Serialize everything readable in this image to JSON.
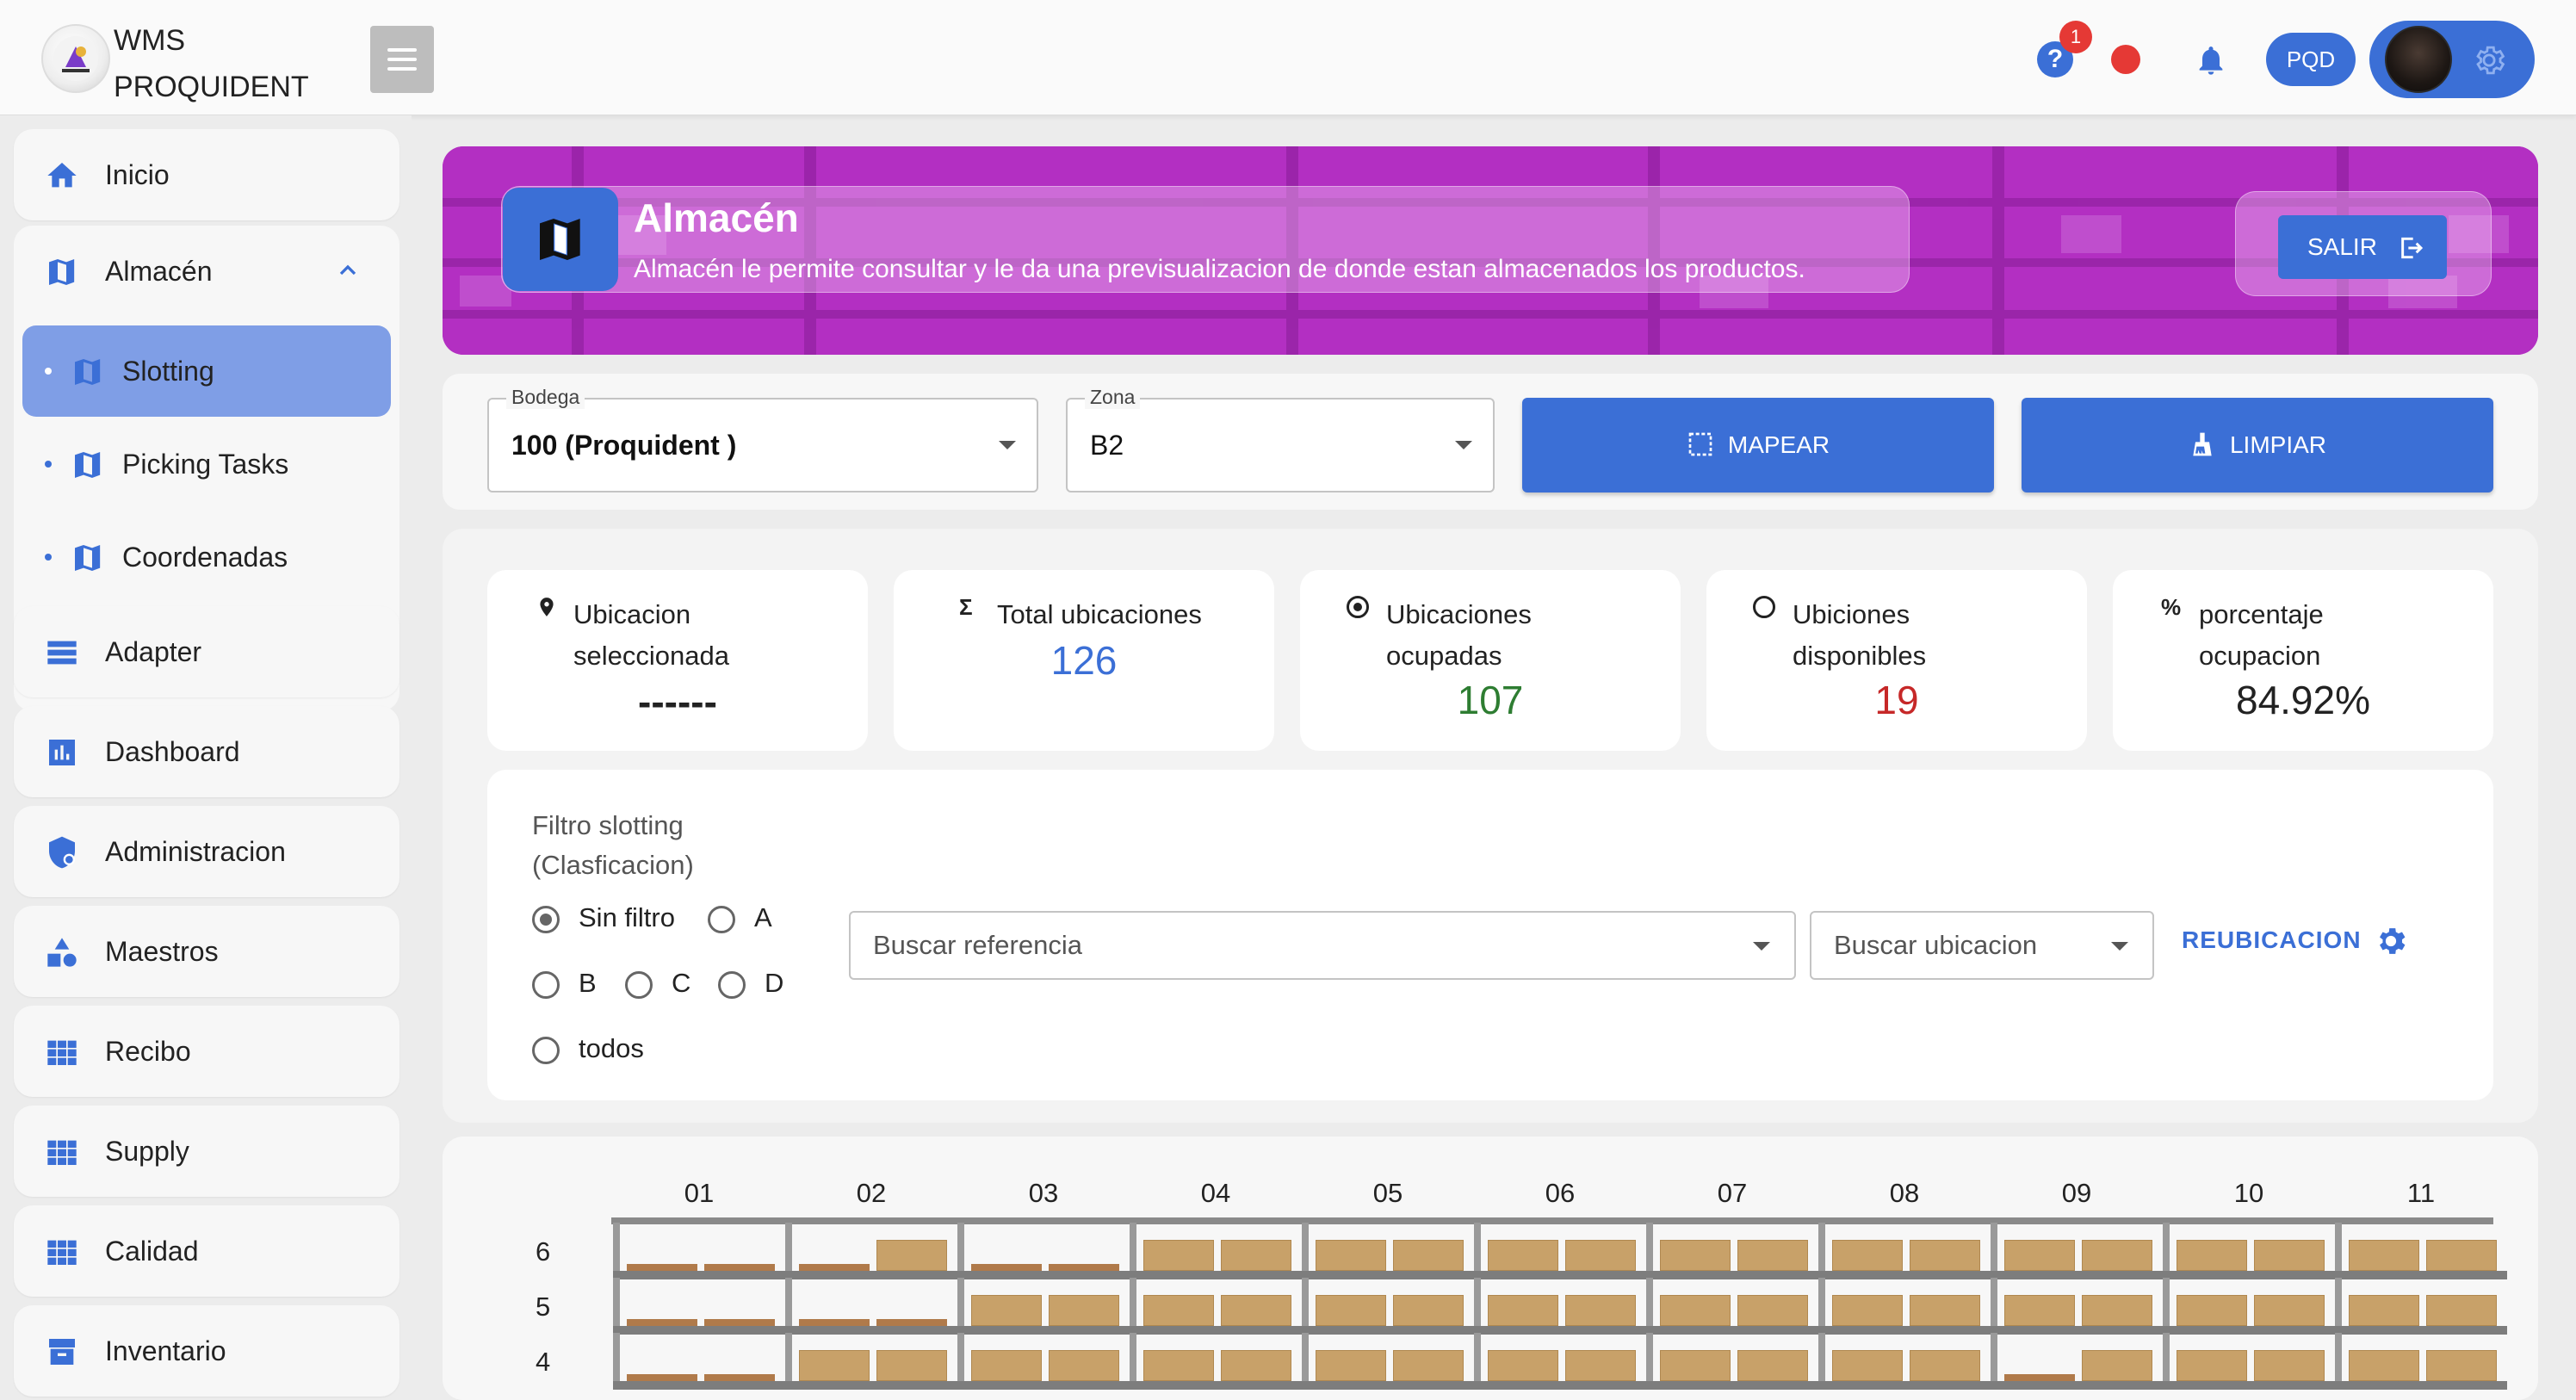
{
  "brand": {
    "line1": "WMS",
    "line2": "PROQUIDENT"
  },
  "topbar": {
    "notification_count": "1",
    "user_badge": "PQD",
    "icons": [
      "menu-icon",
      "help-icon",
      "status-dot-icon",
      "bell-icon",
      "avatar",
      "gear-icon"
    ]
  },
  "sidebar": {
    "items": [
      {
        "label": "Inicio",
        "icon": "home-icon"
      },
      {
        "label": "Almacén",
        "icon": "map-icon",
        "expanded": true,
        "children": [
          {
            "label": "Slotting",
            "active": true
          },
          {
            "label": "Picking Tasks"
          },
          {
            "label": "Coordenadas"
          }
        ]
      },
      {
        "label": "Adapter",
        "icon": "list-icon"
      },
      {
        "label": "Dashboard",
        "icon": "chart-icon"
      },
      {
        "label": "Administracion",
        "icon": "admin-shield-icon"
      },
      {
        "label": "Maestros",
        "icon": "shapes-icon"
      },
      {
        "label": "Recibo",
        "icon": "grid-icon"
      },
      {
        "label": "Supply",
        "icon": "grid-icon"
      },
      {
        "label": "Calidad",
        "icon": "grid-icon"
      },
      {
        "label": "Inventario",
        "icon": "inventory-icon"
      }
    ]
  },
  "hero": {
    "title": "Almacén",
    "description": "Almacén le permite consultar y le da una previsualizacion de donde estan almacenados los productos.",
    "exit_label": "SALIR"
  },
  "filters": {
    "bodega": {
      "label": "Bodega",
      "value": "100 (Proquident )"
    },
    "zona": {
      "label": "Zona",
      "value": "B2"
    },
    "map_button": "MAPEAR",
    "clear_button": "LIMPIAR"
  },
  "stats": [
    {
      "icon": "pin-icon",
      "title_1": "Ubicacion",
      "title_2": "seleccionada",
      "value": "------",
      "color": "#222222"
    },
    {
      "icon": "sigma-icon",
      "title_1": "Total ubicaciones",
      "title_2": "",
      "value": "126",
      "color": "#3b6fd6"
    },
    {
      "icon": "radio-filled-icon",
      "title_1": "Ubicaciones",
      "title_2": "ocupadas",
      "value": "107",
      "color": "#2e7d32"
    },
    {
      "icon": "radio-empty-icon",
      "title_1": "Ubiciones",
      "title_2": "disponibles",
      "value": "19",
      "color": "#c62828"
    },
    {
      "icon": "percent-icon",
      "title_1": "porcentaje",
      "title_2": "ocupacion",
      "value": "84.92%",
      "color": "#222222"
    }
  ],
  "slotting_filter": {
    "title_1": "Filtro slotting",
    "title_2": "(Clasficacion)",
    "options": [
      "Sin filtro",
      "A",
      "B",
      "C",
      "D",
      "todos"
    ],
    "selected": "Sin filtro",
    "search_reference_placeholder": "Buscar referencia",
    "search_location_placeholder": "Buscar ubicacion",
    "relocation_label": "REUBICACION"
  },
  "rack": {
    "columns": [
      "01",
      "02",
      "03",
      "04",
      "05",
      "06",
      "07",
      "08",
      "09",
      "10",
      "11"
    ],
    "rows": [
      "6",
      "5",
      "4"
    ],
    "occupancy": [
      [
        "low",
        "half",
        "low",
        "full",
        "full",
        "full",
        "full",
        "full",
        "full",
        "full",
        "full"
      ],
      [
        "low",
        "low",
        "full",
        "full",
        "full",
        "full",
        "full",
        "full",
        "full",
        "full",
        "full"
      ],
      [
        "low",
        "full",
        "full",
        "full",
        "full",
        "full",
        "full",
        "full",
        "half",
        "full",
        "full"
      ]
    ]
  },
  "colors": {
    "accent": "#3b6fd6",
    "hero": "#b12fbf",
    "active_item": "#7f9ee6",
    "box": "#c8a169"
  }
}
